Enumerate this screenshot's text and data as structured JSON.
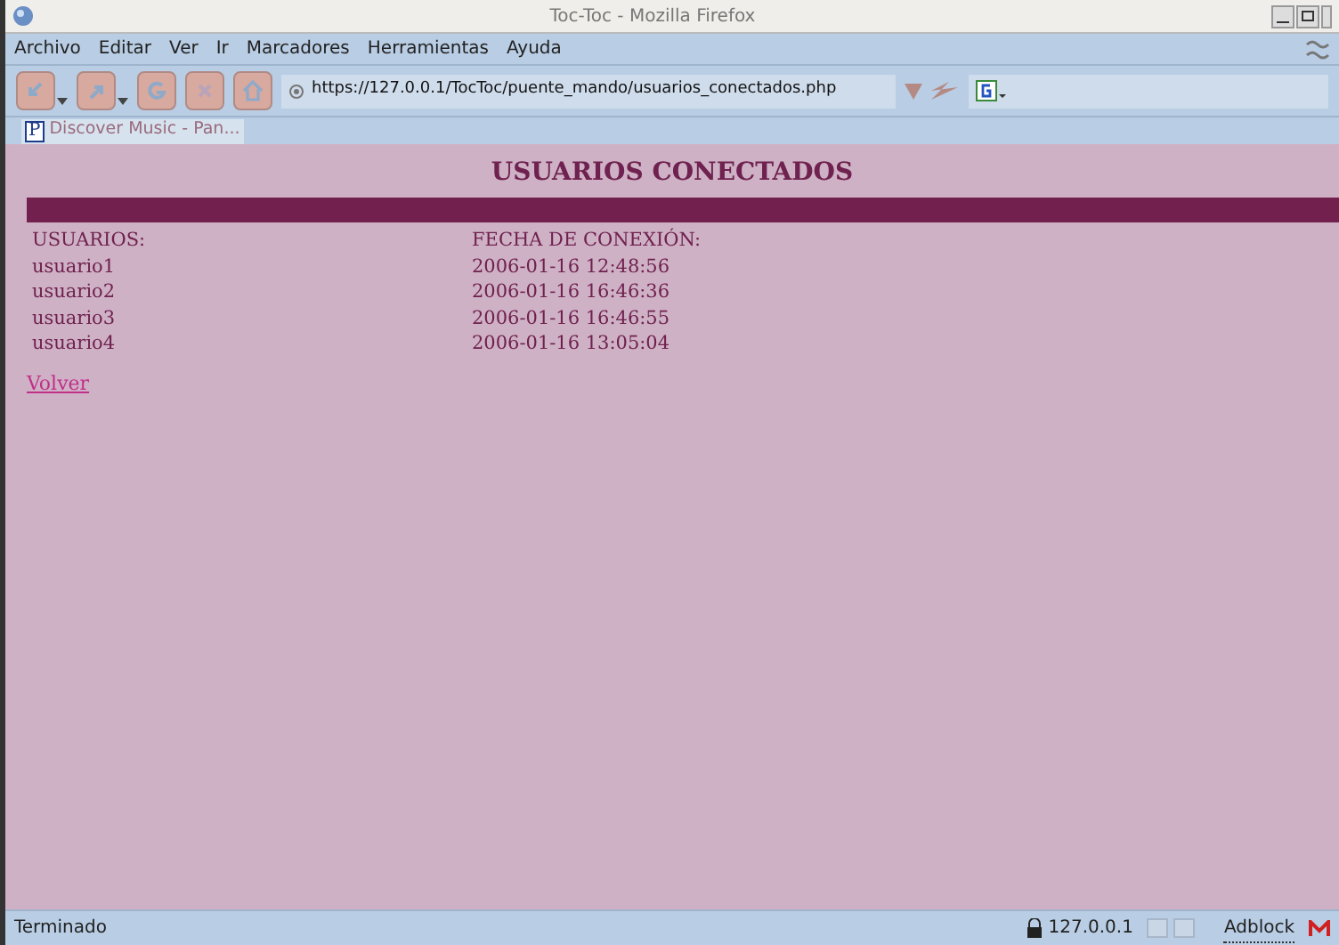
{
  "window": {
    "title": "Toc-Toc - Mozilla Firefox"
  },
  "menu": [
    "Archivo",
    "Editar",
    "Ver",
    "Ir",
    "Marcadores",
    "Herramientas",
    "Ayuda"
  ],
  "address_bar": {
    "value": "https://127.0.0.1/TocToc/puente_mando/usuarios_conectados.php"
  },
  "bookmarks": [
    {
      "icon_letter": "P",
      "label": "Discover Music - Pan..."
    }
  ],
  "page": {
    "heading": "USUARIOS CONECTADOS",
    "columns": [
      "USUARIOS:",
      "FECHA DE CONEXIÓN:"
    ],
    "rows": [
      [
        "usuario1",
        "2006-01-16 12:48:56"
      ],
      [
        "usuario2",
        "2006-01-16 16:46:36"
      ],
      [
        "usuario3",
        "2006-01-16 16:46:55"
      ],
      [
        "usuario4",
        "2006-01-16 13:05:04"
      ]
    ],
    "link": "Volver"
  },
  "status_bar": {
    "status": "Terminado",
    "host": "127.0.0.1",
    "adblock": "Adblock"
  }
}
